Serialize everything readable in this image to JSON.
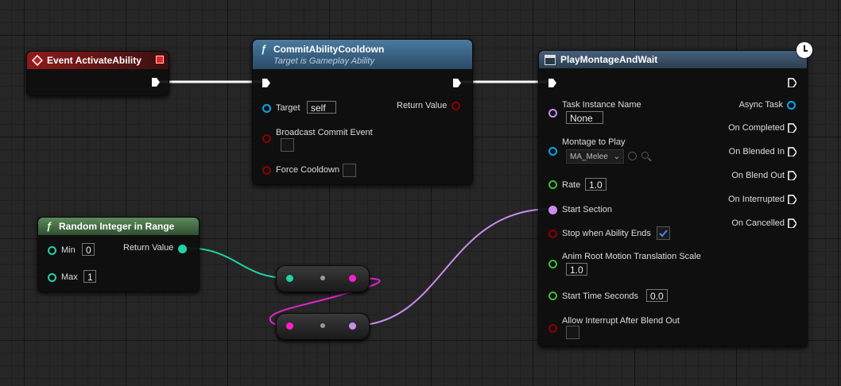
{
  "colors": {
    "exec": "#ffffff",
    "object": "#00a8f0",
    "name": "#c88ff0",
    "bool": "#8c0000",
    "float": "#3fbe2e",
    "integer": "#1fd4a4",
    "delegate": "#ff38d4",
    "event_header": "#8e1b1b",
    "function_header": "#3f6b8e",
    "pure_header": "#4e7a4e"
  },
  "nodes": {
    "event": {
      "title": "Event ActivateAbility"
    },
    "commit": {
      "title": "CommitAbilityCooldown",
      "subtitle": "Target is Gameplay Ability",
      "target_label": "Target",
      "target_value": "self",
      "return_label": "Return Value",
      "broadcast_label": "Broadcast Commit Event",
      "force_label": "Force Cooldown"
    },
    "random": {
      "title": "Random Integer in Range",
      "min_label": "Min",
      "min_value": "0",
      "max_label": "Max",
      "max_value": "1",
      "return_label": "Return Value"
    },
    "montage": {
      "title": "PlayMontageAndWait",
      "task_instance_label": "Task Instance Name",
      "task_instance_value": "None",
      "montage_label": "Montage to Play",
      "montage_value": "MA_Melee",
      "rate_label": "Rate",
      "rate_value": "1.0",
      "start_section_label": "Start Section",
      "stop_label": "Stop when Ability Ends",
      "stop_checked": true,
      "anim_root_label": "Anim Root Motion Translation Scale",
      "anim_root_value": "1.0",
      "start_time_label": "Start Time Seconds",
      "start_time_value": "0.0",
      "allow_interrupt_label": "Allow Interrupt After Blend Out",
      "outputs": [
        "Async Task",
        "On Completed",
        "On Blended In",
        "On Blend Out",
        "On Interrupted",
        "On Cancelled"
      ]
    }
  }
}
